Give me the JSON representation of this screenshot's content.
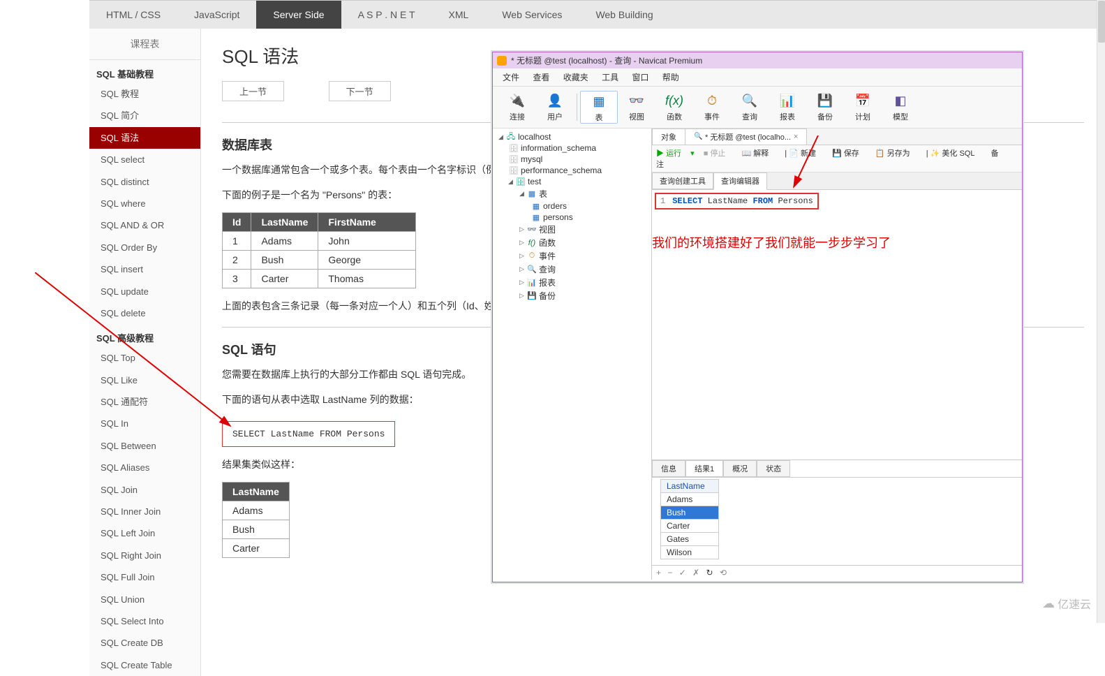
{
  "topnav": [
    "HTML / CSS",
    "JavaScript",
    "Server Side",
    "A S P . N E T",
    "XML",
    "Web Services",
    "Web Building"
  ],
  "topnav_active": 2,
  "sidebar": {
    "title": "课程表",
    "sections": [
      {
        "heading": "SQL 基础教程",
        "items": [
          "SQL 教程",
          "SQL 简介",
          "SQL 语法",
          "SQL select",
          "SQL distinct",
          "SQL where",
          "SQL AND & OR",
          "SQL Order By",
          "SQL insert",
          "SQL update",
          "SQL delete"
        ],
        "active": 2
      },
      {
        "heading": "SQL 高级教程",
        "items": [
          "SQL Top",
          "SQL Like",
          "SQL 通配符",
          "SQL In",
          "SQL Between",
          "SQL Aliases",
          "SQL Join",
          "SQL Inner Join",
          "SQL Left Join",
          "SQL Right Join",
          "SQL Full Join",
          "SQL Union",
          "SQL Select Into",
          "SQL Create DB",
          "SQL Create Table"
        ]
      }
    ]
  },
  "content": {
    "title": "SQL 语法",
    "prev": "上一节",
    "next": "下一节",
    "h2a": "数据库表",
    "p1": "一个数据库通常包含一个或多个表。每个表由一个名字标识（例如\"",
    "p2": "下面的例子是一个名为 \"Persons\" 的表：",
    "table1": {
      "headers": [
        "Id",
        "LastName",
        "FirstName"
      ],
      "rows": [
        [
          "1",
          "Adams",
          "John"
        ],
        [
          "2",
          "Bush",
          "George"
        ],
        [
          "3",
          "Carter",
          "Thomas"
        ]
      ]
    },
    "p3": "上面的表包含三条记录（每一条对应一个人）和五个列（Id、姓、名",
    "h2b": "SQL 语句",
    "p4": "您需要在数据库上执行的大部分工作都由 SQL 语句完成。",
    "p5": "下面的语句从表中选取 LastName 列的数据：",
    "code": "SELECT LastName FROM Persons",
    "p6": "结果集类似这样：",
    "table2": {
      "headers": [
        "LastName"
      ],
      "rows": [
        [
          "Adams"
        ],
        [
          "Bush"
        ],
        [
          "Carter"
        ]
      ]
    }
  },
  "navicat": {
    "window_title": "* 无标题 @test (localhost) - 查询 - Navicat Premium",
    "menubar": [
      "文件",
      "查看",
      "收藏夹",
      "工具",
      "窗口",
      "帮助"
    ],
    "toolbar": [
      {
        "label": "连接",
        "icon": "🔌"
      },
      {
        "label": "用户",
        "icon": "👤"
      },
      {
        "label": "表",
        "icon": "▦",
        "active": true
      },
      {
        "label": "视图",
        "icon": "👓"
      },
      {
        "label": "函数",
        "icon": "f(x)"
      },
      {
        "label": "事件",
        "icon": "⏱"
      },
      {
        "label": "查询",
        "icon": "🔍"
      },
      {
        "label": "报表",
        "icon": "📊"
      },
      {
        "label": "备份",
        "icon": "💾"
      },
      {
        "label": "计划",
        "icon": "📅"
      },
      {
        "label": "模型",
        "icon": "◧"
      }
    ],
    "tree": {
      "conn": "localhost",
      "dbs": [
        "information_schema",
        "mysql",
        "performance_schema"
      ],
      "active_db": "test",
      "tables_label": "表",
      "tables": [
        "orders",
        "persons"
      ],
      "folders": [
        {
          "icon": "👓",
          "label": "视图"
        },
        {
          "icon": "f()",
          "label": "函数"
        },
        {
          "icon": "⏱",
          "label": "事件"
        },
        {
          "icon": "🔍",
          "label": "查询"
        },
        {
          "icon": "📊",
          "label": "报表"
        },
        {
          "icon": "💾",
          "label": "备份"
        }
      ]
    },
    "tabs": {
      "obj": "对象",
      "query": "* 无标题 @test (localho..."
    },
    "actionbar": {
      "run": "运行",
      "stop": "停止",
      "explain": "解释",
      "new": "新建",
      "save": "保存",
      "saveas": "另存为",
      "beautify": "美化 SQL",
      "note": "备注"
    },
    "subtabs": {
      "builder": "查询创建工具",
      "editor": "查询编辑器"
    },
    "sql_line_no": "1",
    "sql_tokens": {
      "select": "SELECT",
      "col": "LastName",
      "from": "FROM",
      "tbl": "Persons"
    },
    "annotation": "我们的环境搭建好了我们就能一步步学习了",
    "result_tabs": [
      "信息",
      "结果1",
      "概况",
      "状态"
    ],
    "result_active": 1,
    "result_header": "LastName",
    "result_rows": [
      "Adams",
      "Bush",
      "Carter",
      "Gates",
      "Wilson"
    ],
    "result_selected": 1,
    "result_toolbar": [
      "+",
      "−",
      "✓",
      "✗",
      "↻",
      "⟲"
    ]
  },
  "watermark": "亿速云"
}
